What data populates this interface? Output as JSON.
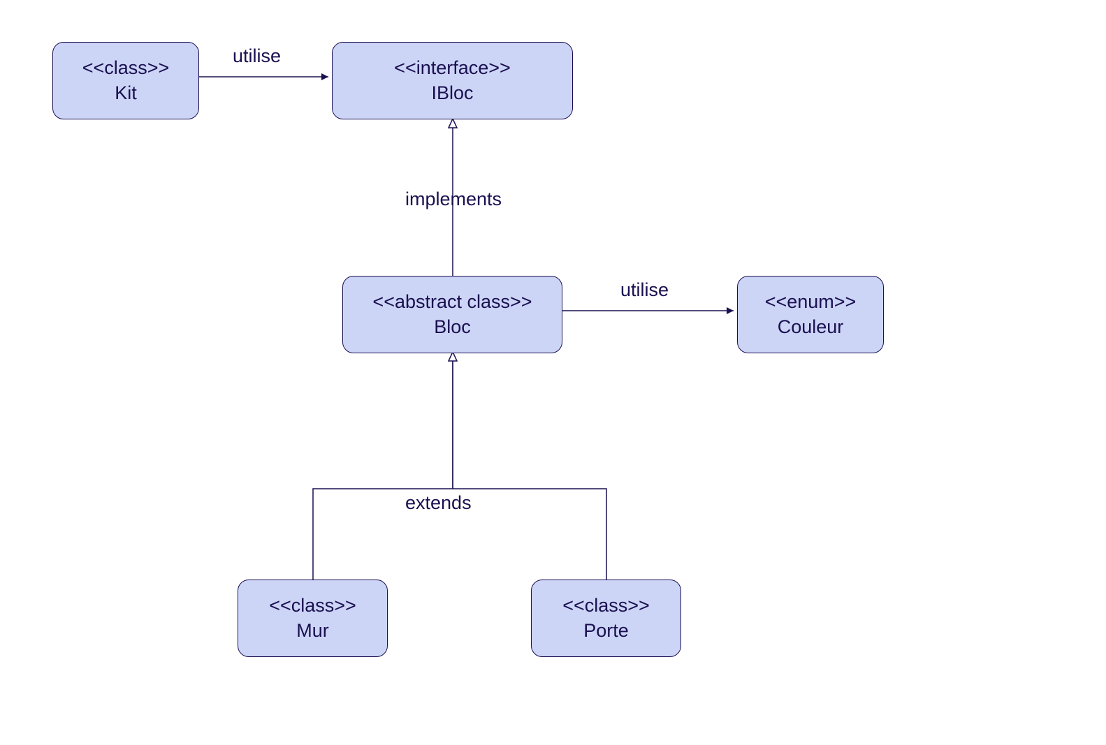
{
  "nodes": {
    "kit": {
      "stereotype": "<<class>>",
      "name": "Kit"
    },
    "ibloc": {
      "stereotype": "<<interface>>",
      "name": "IBloc"
    },
    "bloc": {
      "stereotype": "<<abstract class>>",
      "name": "Bloc"
    },
    "couleur": {
      "stereotype": "<<enum>>",
      "name": "Couleur"
    },
    "mur": {
      "stereotype": "<<class>>",
      "name": "Mur"
    },
    "porte": {
      "stereotype": "<<class>>",
      "name": "Porte"
    }
  },
  "edges": {
    "kit_ibloc": "utilise",
    "bloc_ibloc": "implements",
    "bloc_couleur": "utilise",
    "subclasses_bloc": "extends"
  }
}
